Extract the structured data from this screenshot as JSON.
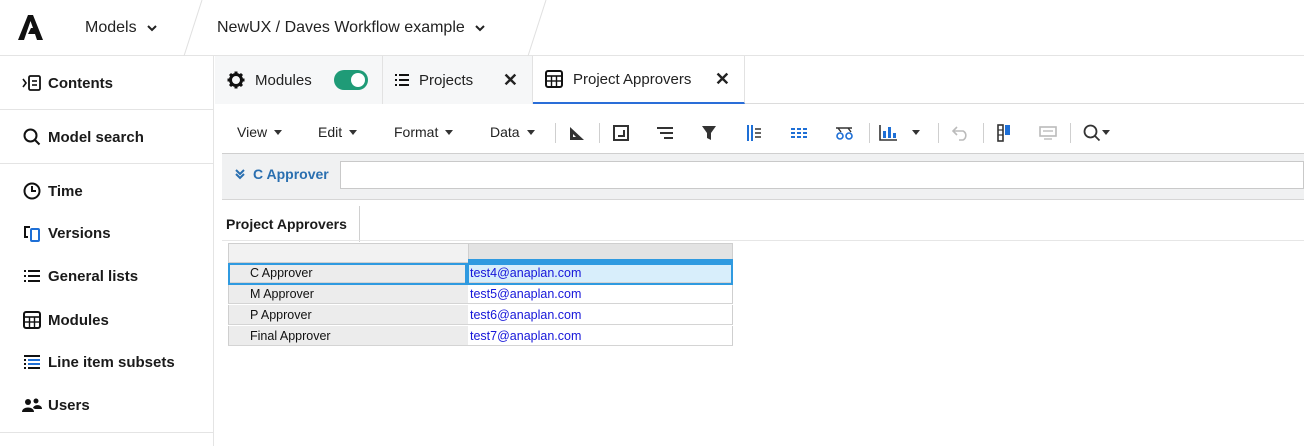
{
  "header": {
    "models_label": "Models",
    "workspace_path": "NewUX / Daves Workflow example"
  },
  "sidebar": {
    "items": [
      {
        "label": "Contents",
        "icon": "contents-icon"
      },
      {
        "label": "Model search",
        "icon": "search-icon"
      },
      {
        "label": "Time",
        "icon": "clock-icon"
      },
      {
        "label": "Versions",
        "icon": "versions-icon"
      },
      {
        "label": "General lists",
        "icon": "list-icon"
      },
      {
        "label": "Modules",
        "icon": "grid-icon"
      },
      {
        "label": "Line item subsets",
        "icon": "subset-list-icon"
      },
      {
        "label": "Users",
        "icon": "users-icon"
      }
    ]
  },
  "tabs": [
    {
      "label": "Modules",
      "toggle_on": true
    },
    {
      "label": "Projects",
      "closable": true
    },
    {
      "label": "Project Approvers",
      "closable": true,
      "active": true
    }
  ],
  "toolbar": {
    "menus": [
      "View",
      "Edit",
      "Format",
      "Data"
    ]
  },
  "page_selector": {
    "label": "C Approver",
    "value": ""
  },
  "grid": {
    "tab_label": "Project Approvers",
    "rows": [
      {
        "label": "C Approver",
        "value": "test4@anaplan.com",
        "selected": true
      },
      {
        "label": "M Approver",
        "value": "test5@anaplan.com"
      },
      {
        "label": "P Approver",
        "value": "test6@anaplan.com"
      },
      {
        "label": "Final Approver",
        "value": "test7@anaplan.com"
      }
    ]
  },
  "colors": {
    "accent": "#2a6ed8",
    "toggle_on": "#1f9b77",
    "link_text": "#1616d9",
    "selection": "#2f9ae0"
  }
}
